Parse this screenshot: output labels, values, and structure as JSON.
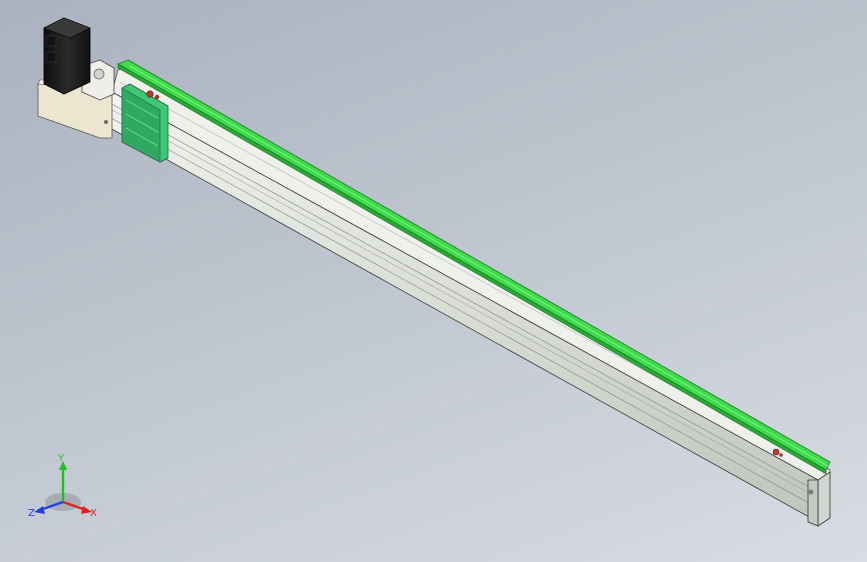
{
  "viewport": {
    "background_top": "#a9b2bf",
    "background_bottom": "#d8dce3"
  },
  "model": {
    "rail_color": "#3ddc4a",
    "profile_color": "#dfe3df",
    "motor_color": "#1c1c1c",
    "bracket_color": "#e8e4d0",
    "carriage_color": "#3fc777",
    "marker_color": "#c0392b"
  },
  "triad": {
    "x_label": "X",
    "y_label": "Y",
    "z_label": "Z",
    "x_color": "#e02020",
    "y_color": "#20c020",
    "z_color": "#2040e0"
  }
}
